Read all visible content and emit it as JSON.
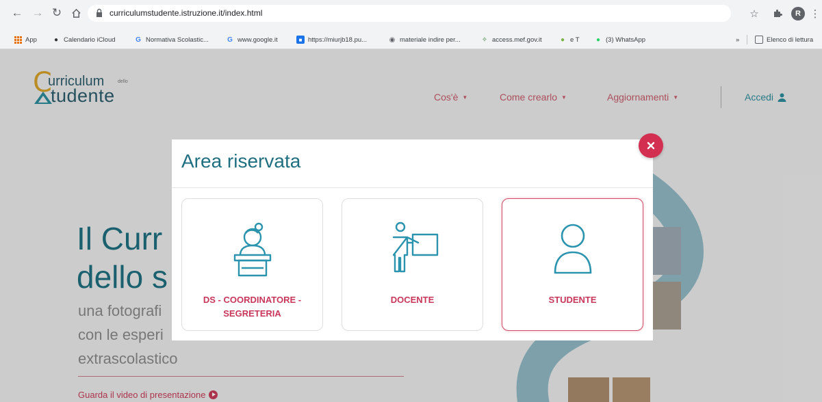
{
  "browser": {
    "url": "curriculumstudente.istruzione.it/index.html",
    "avatar_letter": "R",
    "bookmarks": [
      {
        "label": "App",
        "icon": "apps-grid-icon"
      },
      {
        "label": "Calendario iCloud",
        "icon": "apple-icon"
      },
      {
        "label": "Normativa Scolastic...",
        "icon": "google-icon"
      },
      {
        "label": "www.google.it",
        "icon": "google-icon"
      },
      {
        "label": "https://miurjb18.pu...",
        "icon": "site-icon"
      },
      {
        "label": "materiale indire per...",
        "icon": "globe-icon"
      },
      {
        "label": "access.mef.gov.it",
        "icon": "mef-icon"
      },
      {
        "label": "e T",
        "icon": "leaf-icon"
      },
      {
        "label": "(3) WhatsApp",
        "icon": "whatsapp-icon"
      }
    ],
    "more_bookmarks": "»",
    "reading_list": "Elenco di lettura"
  },
  "site": {
    "logo": {
      "c": "C",
      "urriculum": "urriculum",
      "della": "dello",
      "tudente": "tudente"
    },
    "nav": [
      {
        "label": "Cos'è"
      },
      {
        "label": "Come crearlo"
      },
      {
        "label": "Aggiornamenti"
      }
    ],
    "login_label": "Accedi",
    "hero": {
      "title_line1": "Il Curr",
      "title_line2": "dello s",
      "sub_line1": "una fotografi",
      "sub_line2": "con le esperi",
      "sub_line3": "extrascolastico"
    },
    "video_link": "Guarda il video di presentazione"
  },
  "modal": {
    "title": "Area riservata",
    "cards": [
      {
        "label_line1": "DS - COORDINATORE -",
        "label_line2": "SEGRETERIA",
        "icon": "secretary-desk-icon"
      },
      {
        "label_line1": "DOCENTE",
        "label_line2": "",
        "icon": "teacher-board-icon"
      },
      {
        "label_line1": "STUDENTE",
        "label_line2": "",
        "icon": "student-user-icon"
      }
    ]
  },
  "colors": {
    "accent_teal": "#1f6f80",
    "accent_pink": "#c9365a",
    "close_red": "#d32f50"
  }
}
